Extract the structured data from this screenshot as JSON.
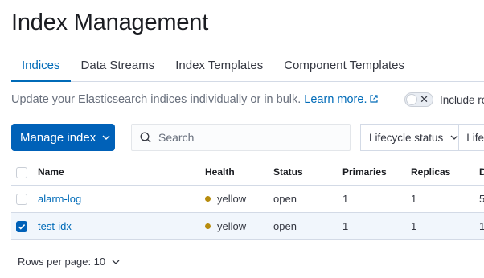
{
  "page": {
    "title": "Index Management"
  },
  "tabs": [
    {
      "label": "Indices",
      "selected": true
    },
    {
      "label": "Data Streams",
      "selected": false
    },
    {
      "label": "Index Templates",
      "selected": false
    },
    {
      "label": "Component Templates",
      "selected": false
    }
  ],
  "intro": {
    "text": "Update your Elasticsearch indices individually or in bulk. ",
    "link": "Learn more.",
    "link_icon": "external-link-icon"
  },
  "toggle": {
    "label": "Include ro",
    "checked": false,
    "icon": "cross-icon"
  },
  "toolbar": {
    "manage_label": "Manage index",
    "manage_icon": "chevron-down-icon",
    "search_placeholder": "Search",
    "search_icon": "search-icon",
    "filter_lifecycle_status": "Lifecycle status",
    "filter_lifecycle_phase": "Lifec"
  },
  "table": {
    "columns": [
      "Name",
      "Health",
      "Status",
      "Primaries",
      "Replicas",
      "D"
    ],
    "rows": [
      {
        "name": "alarm-log",
        "health": "yellow",
        "status": "open",
        "primaries": "1",
        "replicas": "1",
        "docs": "5",
        "checked": false
      },
      {
        "name": "test-idx",
        "health": "yellow",
        "status": "open",
        "primaries": "1",
        "replicas": "1",
        "docs": "1",
        "checked": true
      }
    ]
  },
  "pagination": {
    "label": "Rows per page: 10",
    "icon": "chevron-down-icon"
  },
  "colors": {
    "accent": "#0061b8",
    "link": "#006bb8",
    "health_yellow": "#b78c0e",
    "selected_row": "#f1f6fc"
  }
}
